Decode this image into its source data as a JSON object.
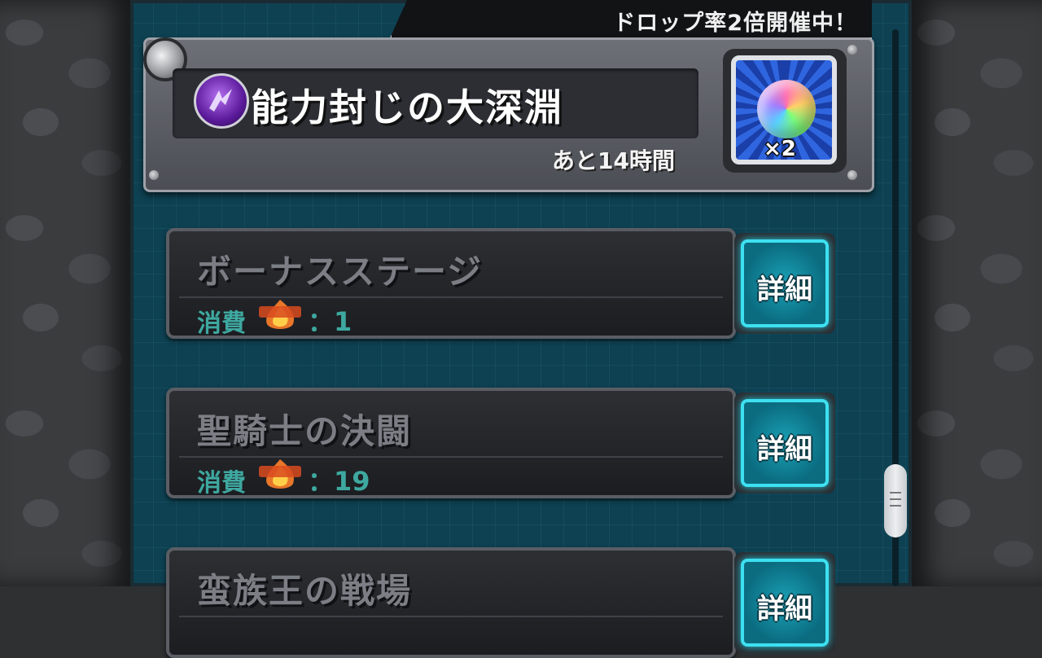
{
  "banner": {
    "text": "ドロップ率2倍開催中！"
  },
  "dungeon": {
    "element_icon": "dark-element-icon",
    "name": "能力封じの大深淵",
    "time_remaining": "あと14時間",
    "reward": {
      "icon": "rainbow-orb-icon",
      "multiplier": "×2"
    }
  },
  "quests": [
    {
      "title": "ボーナスステージ",
      "cost_label": "消費",
      "stamina_icon": "stamina-icon",
      "cost_value": "：1",
      "detail_label": "詳細"
    },
    {
      "title": "聖騎士の決闘",
      "cost_label": "消費",
      "stamina_icon": "stamina-icon",
      "cost_value": "：19",
      "detail_label": "詳細"
    },
    {
      "title": "蛮族王の戦場",
      "detail_label": "詳細"
    }
  ],
  "colors": {
    "panel": "#0e4152",
    "accent": "#3de0f0",
    "cost_text": "#3ea8a0"
  }
}
